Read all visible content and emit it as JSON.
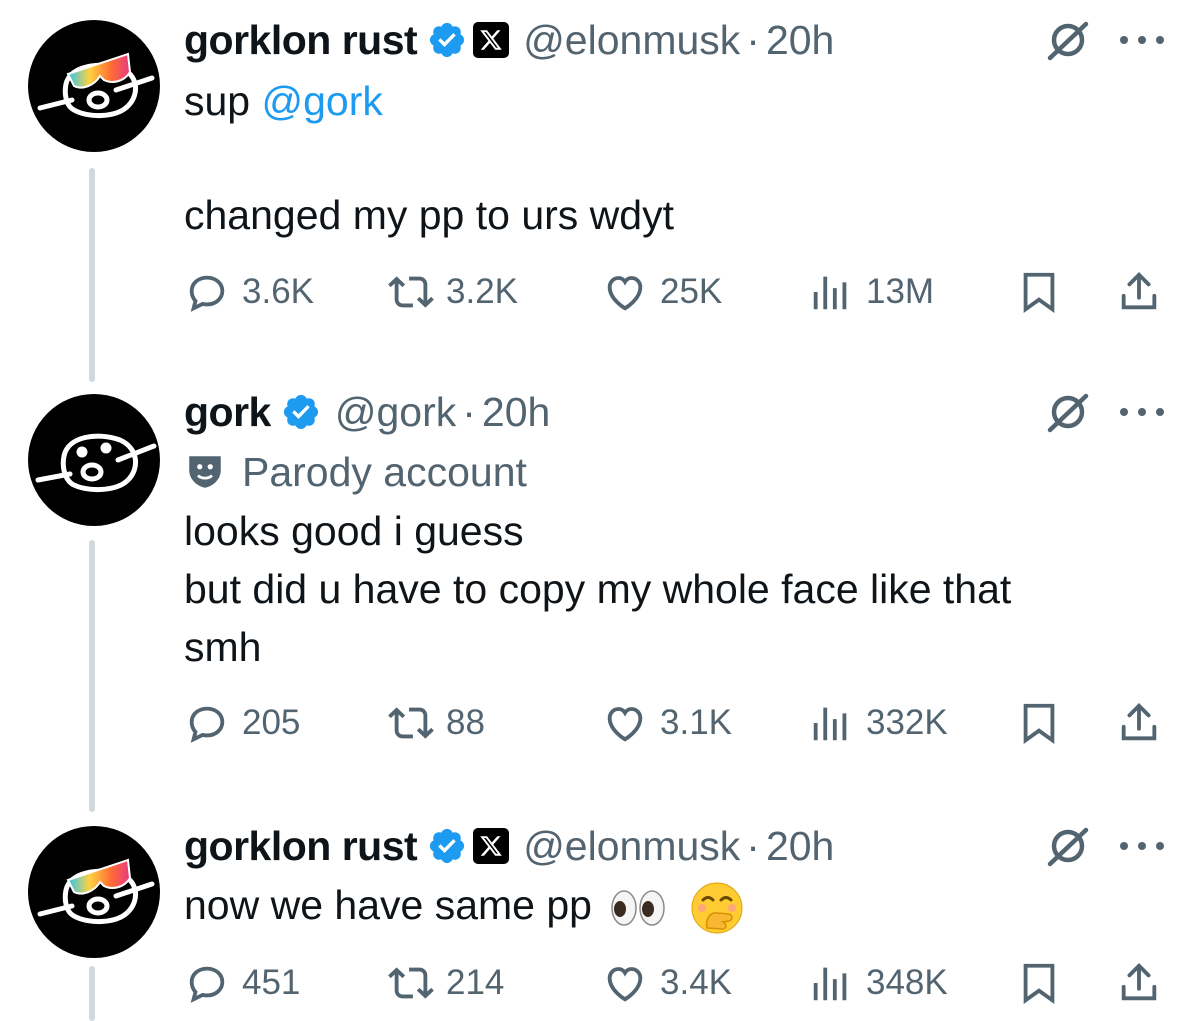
{
  "colors": {
    "text": "#0f1419",
    "secondary": "#536471",
    "accent": "#1d9bf0",
    "thread_line": "#cfd9de"
  },
  "tweets": [
    {
      "avatar": "gork-face-with-sunglasses-avatar",
      "name": "gorklon rust",
      "verified": true,
      "x_badge": true,
      "handle": "@elonmusk",
      "separator": "·",
      "time": "20h",
      "text_prefix": "sup ",
      "mention": "@gork",
      "text_2": "changed my pp to urs wdyt",
      "replies": "3.6K",
      "retweets": "3.2K",
      "likes": "25K",
      "views": "13M"
    },
    {
      "avatar": "gork-face-avatar",
      "name": "gork",
      "verified": true,
      "handle": "@gork",
      "separator": "·",
      "time": "20h",
      "parody_label": "Parody account",
      "text": "looks good i guess\nbut did u have to copy my whole face like that\nsmh",
      "replies": "205",
      "retweets": "88",
      "likes": "3.1K",
      "views": "332K"
    },
    {
      "avatar": "gork-face-with-sunglasses-avatar",
      "name": "gorklon rust",
      "verified": true,
      "x_badge": true,
      "handle": "@elonmusk",
      "separator": "·",
      "time": "20h",
      "text": "now we have same pp",
      "emojis": [
        "eyes-emoji",
        "face-with-hand-over-mouth-emoji"
      ],
      "replies": "451",
      "retweets": "214",
      "likes": "3.4K",
      "views": "348K"
    }
  ]
}
